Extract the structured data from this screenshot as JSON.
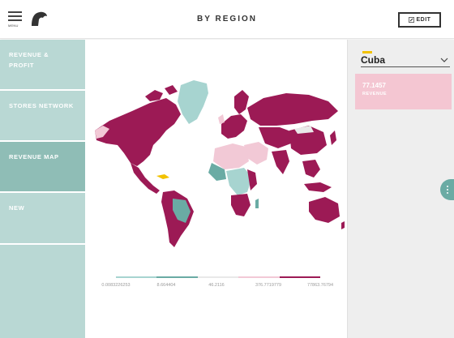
{
  "header": {
    "menu_label": "MENU",
    "title": "BY REGION",
    "edit_label": "EDIT"
  },
  "sidebar": {
    "items": [
      {
        "label": "REVENUE & PROFIT",
        "active": false
      },
      {
        "label": "STORES NETWORK",
        "active": false
      },
      {
        "label": "REVENUE MAP",
        "active": true
      },
      {
        "label": "NEW",
        "active": false
      }
    ]
  },
  "legend": {
    "colors": [
      "#a7d4d0",
      "#6aaba4",
      "#e9e9e9",
      "#f2c9d6",
      "#9c1a55"
    ],
    "labels": [
      "0.0083226253",
      "8.664404",
      "46.2116",
      "376.7719779",
      "77863.76794"
    ]
  },
  "map_colors": {
    "dark": "#9c1a55",
    "teal": "#a7d4d0",
    "teal_dark": "#6aaba4",
    "pink": "#f2c9d6",
    "highlight": "#f2c200"
  },
  "panel": {
    "selected_country": "Cuba",
    "metric_value": "77.1457",
    "metric_label": "REVENUE",
    "accent": "#f2c200"
  }
}
